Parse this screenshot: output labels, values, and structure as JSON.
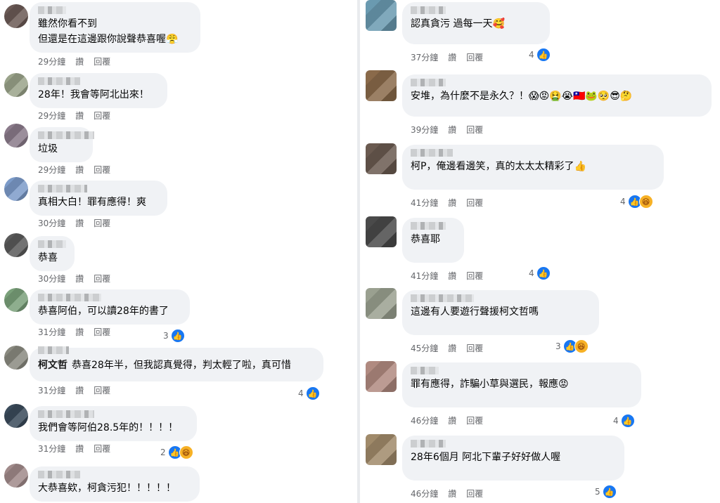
{
  "left": {
    "comments": [
      {
        "text": "雖然你看不到\n但還是在這邊跟你說聲恭喜喔😤",
        "time": "29分鐘",
        "like": "讚",
        "reply": "回覆",
        "avatar_color": "#6b5a55"
      },
      {
        "text": "28年！我會等阿北出來！",
        "time": "29分鐘",
        "like": "讚",
        "reply": "回覆",
        "avatar_color": "#9aa38a"
      },
      {
        "text": "垃圾",
        "time": "29分鐘",
        "like": "讚",
        "reply": "回覆",
        "avatar_color": "#8a7a8a"
      },
      {
        "text": "真相大白！罪有應得！爽",
        "time": "30分鐘",
        "like": "讚",
        "reply": "回覆",
        "avatar_color": "#7c9bc9"
      },
      {
        "text": "恭喜",
        "time": "30分鐘",
        "like": "讚",
        "reply": "回覆",
        "avatar_color": "#5a5a5a"
      },
      {
        "text": "恭喜阿伯，可以讀28年的書了",
        "time": "31分鐘",
        "like": "讚",
        "reply": "回覆",
        "reaction_count": "3",
        "avatar_color": "#7aa07a"
      },
      {
        "author": "柯文哲",
        "text": "恭喜28年半，但我認真覺得，判太輕了啦，真可惜",
        "time": "31分鐘",
        "like": "讚",
        "reply": "回覆",
        "reaction_count": "4",
        "avatar_color": "#8a8a80"
      },
      {
        "text": "我們會等阿伯28.5年的！！！！",
        "time": "31分鐘",
        "like": "讚",
        "reply": "回覆",
        "reaction_count": "2",
        "avatar_color": "#3a4a5a"
      },
      {
        "text": "大恭喜欸，柯貪污犯！！！！！",
        "time": "",
        "like": "",
        "reply": "",
        "avatar_color": "#a08a8a"
      }
    ]
  },
  "right": {
    "comments": [
      {
        "text": "認真貪污 過每一天🥰",
        "time": "37分鐘",
        "like": "讚",
        "reply": "回覆",
        "reaction_count": "4",
        "avatar_color": "#6a9ab0"
      },
      {
        "text": "安堆，為什麼不是永久？！😱😡🤮😭🇹🇼🐸🥺😎🤔",
        "time": "39分鐘",
        "like": "讚",
        "reply": "回覆",
        "avatar_color": "#8a6a4a"
      },
      {
        "text": "柯P，俺邊看邊笑，真的太太太精彩了👍",
        "time": "41分鐘",
        "like": "讚",
        "reply": "回覆",
        "reaction_count": "4",
        "avatar_color": "#6a5a50"
      },
      {
        "text": "恭喜耶",
        "time": "41分鐘",
        "like": "讚",
        "reply": "回覆",
        "reaction_count": "4",
        "avatar_color": "#4a4a4a"
      },
      {
        "text": "這邊有人要遊行聲援柯文哲嗎",
        "time": "45分鐘",
        "like": "讚",
        "reply": "回覆",
        "reaction_count": "3",
        "avatar_color": "#9aa090"
      },
      {
        "text": "罪有應得，詐騙小草與選民，報應😡",
        "time": "46分鐘",
        "like": "讚",
        "reply": "回覆",
        "reaction_count": "4",
        "avatar_color": "#b08a80"
      },
      {
        "text": "28年6個月 阿北下輩子好好做人喔",
        "time": "46分鐘",
        "like": "讚",
        "reply": "回覆",
        "reaction_count": "5",
        "avatar_color": "#a08a6a"
      }
    ]
  },
  "icons": {
    "like": "👍",
    "haha": "😆"
  },
  "colors": {
    "bubble": "#f0f2f5",
    "meta": "#65676b",
    "like_blue": "#1877f2"
  }
}
